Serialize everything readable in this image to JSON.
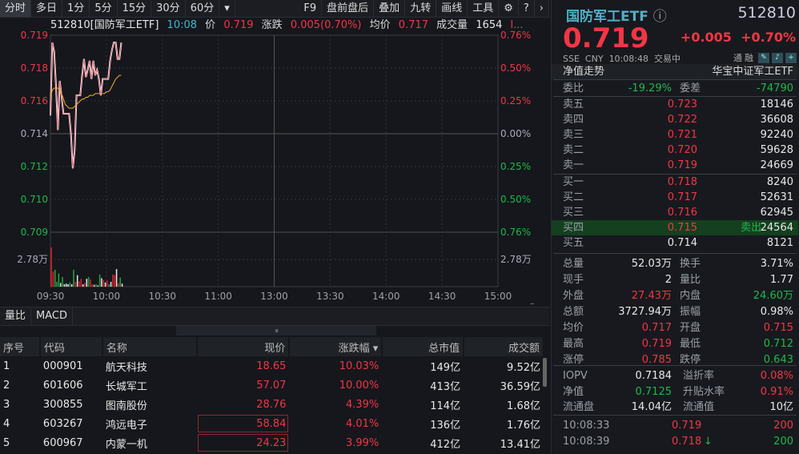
{
  "toolbar": {
    "items": [
      "分时",
      "多日",
      "1分",
      "5分",
      "15分",
      "30分",
      "60分",
      "▾"
    ],
    "right": [
      "F9",
      "盘前盘后",
      "叠加",
      "九转",
      "画线",
      "工具"
    ],
    "active": "分时"
  },
  "info": {
    "code": "512810[国防军工ETF]",
    "time": "10:08",
    "price_label": "价",
    "price": "0.719",
    "change_label": "涨跌",
    "change": "0.005(0.70%)",
    "avg_label": "均价",
    "avg": "0.717",
    "vol_label": "成交量",
    "vol": "1654",
    "more": "l..."
  },
  "chart_data": {
    "type": "line",
    "prev_close": 0.714,
    "ylim": [
      0.7086,
      0.7194
    ],
    "y_left_labels": [
      "0.719",
      "0.718",
      "0.716",
      "0.714",
      "0.712",
      "0.710",
      "0.709"
    ],
    "y_right_labels": [
      "0.76%",
      "0.50%",
      "0.25%",
      "0.00%",
      "0.25%",
      "0.50%",
      "0.76%"
    ],
    "x_labels": [
      "09:30",
      "10:00",
      "10:30",
      "11:00",
      "13:00",
      "13:30",
      "14:00",
      "14:30",
      "15:00"
    ],
    "vol_label": "2.78万",
    "price": [
      0.715,
      0.719,
      0.7185,
      0.7166,
      0.7142,
      0.7169,
      0.716,
      0.7151,
      0.7151,
      0.7151,
      0.7151,
      0.714,
      0.7121,
      0.7131,
      0.7161,
      0.7161,
      0.7161,
      0.7172,
      0.7181,
      0.7171,
      0.7175,
      0.718,
      0.717,
      0.718,
      0.7172,
      0.7175,
      0.717,
      0.7161,
      0.717,
      0.717,
      0.717,
      0.717,
      0.718,
      0.7186,
      0.719,
      0.719,
      0.7181,
      0.7181,
      0.719
    ],
    "avg": [
      0.716,
      0.7164,
      0.7165,
      0.7165,
      0.7165,
      0.7164,
      0.7162,
      0.7159,
      0.7156,
      0.7155,
      0.7154,
      0.7154,
      0.7154,
      0.7155,
      0.7156,
      0.7157,
      0.7158,
      0.7159,
      0.7159,
      0.716,
      0.716,
      0.7161,
      0.7161,
      0.7161,
      0.7162,
      0.7162,
      0.7162,
      0.7162,
      0.7162,
      0.7162,
      0.7163,
      0.7163,
      0.7164,
      0.7166,
      0.7168,
      0.717,
      0.7171,
      0.7172,
      0.7172
    ],
    "volume": [
      6.5,
      2.5,
      2.8,
      0.8,
      2.2,
      0.6,
      1.6,
      0.4,
      0.5,
      0.4,
      0.7,
      0.4,
      2.8,
      0.8,
      1.9,
      0.9,
      1.3,
      0.4,
      0.6,
      1.3,
      1.6,
      1.2,
      0.4,
      0.3,
      0.4,
      0.2,
      2.0,
      1.4,
      1.1,
      0.7,
      1.0,
      0.4,
      0.8,
      2.0,
      1.9,
      2.9,
      0.6,
      1.5,
      0.5
    ],
    "vol_colors": [
      "r",
      "r",
      "g",
      "g",
      "g",
      "w",
      "g",
      "w",
      "w",
      "w",
      "g",
      "w",
      "g",
      "r",
      "w",
      "r",
      "r",
      "w",
      "r",
      "w",
      "g",
      "r",
      "r",
      "w",
      "g",
      "w",
      "g",
      "w",
      "r",
      "w",
      "r",
      "g",
      "w",
      "r",
      "r",
      "w",
      "r",
      "g",
      "w"
    ],
    "vol_max": 9.0
  },
  "bottom_tabs": [
    "量比",
    "MACD"
  ],
  "collapse": "»",
  "table": {
    "headers": [
      "序号",
      "代码",
      "名称",
      "现价",
      "涨跌幅 ▾",
      "总市值",
      "成交额"
    ],
    "rows": [
      [
        "1",
        "000901",
        "航天科技",
        "18.65",
        "10.03%",
        "149亿",
        "9.52亿"
      ],
      [
        "2",
        "601606",
        "长城军工",
        "57.07",
        "10.00%",
        "413亿",
        "36.59亿"
      ],
      [
        "3",
        "300855",
        "图南股份",
        "28.76",
        "4.39%",
        "114亿",
        "1.68亿"
      ],
      [
        "4",
        "603267",
        "鸿远电子",
        "58.84",
        "4.01%",
        "136亿",
        "1.76亿"
      ],
      [
        "5",
        "600967",
        "内蒙一机",
        "24.23",
        "3.99%",
        "412亿",
        "13.41亿"
      ]
    ]
  },
  "quote": {
    "name": "国防军工ETF",
    "info_icon": "ⓘ",
    "code": "512810",
    "price": "0.719",
    "change": "+0.005",
    "pct": "+0.70%",
    "exchange": "SSE",
    "currency": "CNY",
    "time": "10:08:48",
    "status": "交易中",
    "tong": "通",
    "rong": "融",
    "nav_trend": "净值走势",
    "index_name": "华宝中证军工ETF"
  },
  "ratio": {
    "l1": "委比",
    "v1": "-19.29%",
    "l2": "委差",
    "v2": "-74790"
  },
  "asks": [
    [
      "卖五",
      "0.723",
      "18146"
    ],
    [
      "卖四",
      "0.722",
      "36608"
    ],
    [
      "卖三",
      "0.721",
      "92240"
    ],
    [
      "卖二",
      "0.720",
      "59628"
    ],
    [
      "卖一",
      "0.719",
      "24669"
    ]
  ],
  "bids": [
    [
      "买一",
      "0.718",
      "8240"
    ],
    [
      "买二",
      "0.717",
      "52631"
    ],
    [
      "买三",
      "0.716",
      "62945"
    ],
    [
      "买四",
      "0.715",
      "24564"
    ],
    [
      "买五",
      "0.714",
      "8121"
    ]
  ],
  "sell_tag": "卖出",
  "stats": [
    [
      "总量",
      "52.03万",
      "w",
      "换手",
      "3.71%",
      "w"
    ],
    [
      "现手",
      "2",
      "w",
      "量比",
      "1.77",
      "w"
    ],
    [
      "外盘",
      "27.43万",
      "r",
      "内盘",
      "24.60万",
      "g"
    ],
    [
      "总额",
      "3727.94万",
      "w",
      "振幅",
      "0.98%",
      "w"
    ],
    [
      "均价",
      "0.717",
      "r",
      "开盘",
      "0.715",
      "r"
    ],
    [
      "最高",
      "0.719",
      "r",
      "最低",
      "0.712",
      "g"
    ],
    [
      "涨停",
      "0.785",
      "r",
      "跌停",
      "0.643",
      "g"
    ]
  ],
  "etf": [
    [
      "IOPV",
      "0.7184",
      "w",
      "溢折率",
      "0.08%",
      "r"
    ],
    [
      "净值",
      "0.7125",
      "g",
      "升贴水率",
      "0.91%",
      "r"
    ],
    [
      "流通盘",
      "14.04亿",
      "w",
      "流通值",
      "10亿",
      "w"
    ]
  ],
  "ticks": [
    [
      "10:08:33",
      "0.719",
      "",
      "200",
      "r"
    ],
    [
      "10:08:39",
      "0.718",
      "↓",
      "200",
      "g"
    ]
  ]
}
